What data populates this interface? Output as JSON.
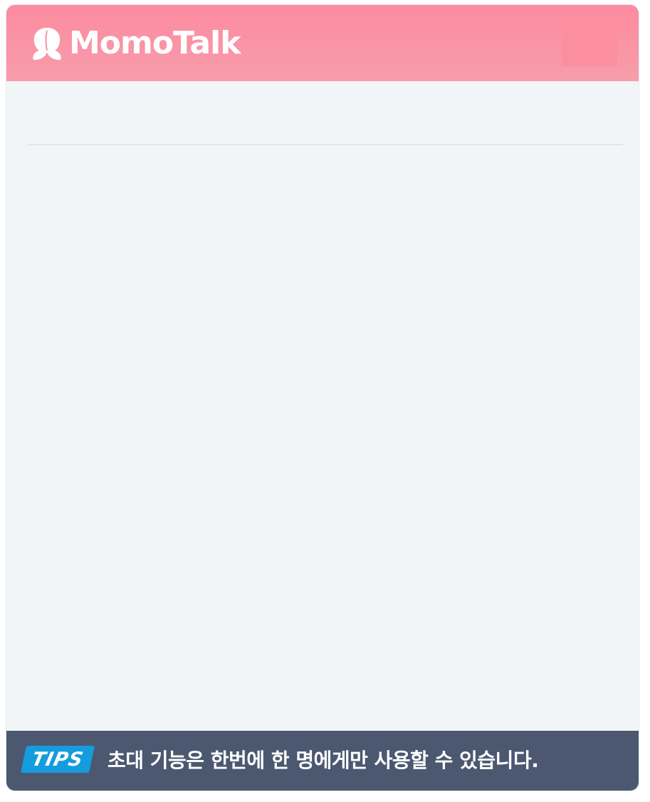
{
  "app": {
    "title": "MomoTalk",
    "logo_icon": "peach-icon"
  },
  "colors": {
    "header_top": "#fd8aa0",
    "header_bottom": "#f79dab",
    "body_bg": "#f2f5f7",
    "tips_bar_bg": "#4b5870",
    "tips_badge_bg": "#159cde"
  },
  "tips": {
    "badge_label": "TIPS",
    "message": "초대 기능은 한번에 한 명에게만 사용할 수 있습니다."
  }
}
